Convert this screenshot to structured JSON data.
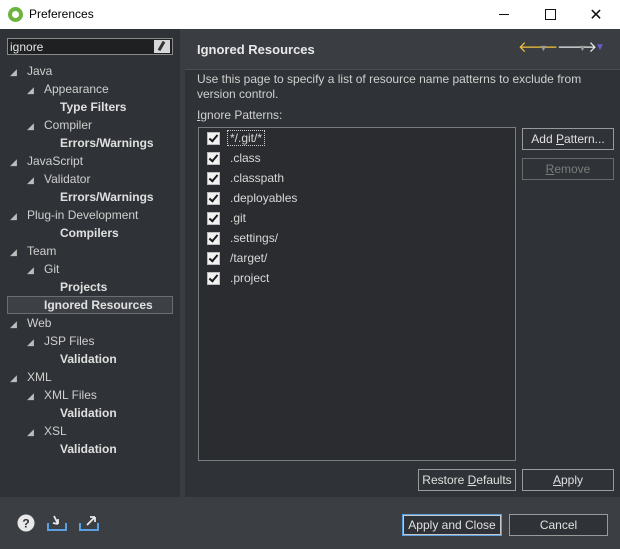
{
  "window": {
    "title": "Preferences"
  },
  "filter": {
    "value": "ignore"
  },
  "tree": [
    {
      "label": "Java",
      "level": 0,
      "bold": false,
      "arrow": true
    },
    {
      "label": "Appearance",
      "level": 1,
      "bold": false,
      "arrow": true
    },
    {
      "label": "Type Filters",
      "level": 2,
      "bold": true,
      "arrow": false
    },
    {
      "label": "Compiler",
      "level": 1,
      "bold": false,
      "arrow": true
    },
    {
      "label": "Errors/Warnings",
      "level": 2,
      "bold": true,
      "arrow": false
    },
    {
      "label": "JavaScript",
      "level": 0,
      "bold": false,
      "arrow": true
    },
    {
      "label": "Validator",
      "level": 1,
      "bold": false,
      "arrow": true
    },
    {
      "label": "Errors/Warnings",
      "level": 2,
      "bold": true,
      "arrow": false
    },
    {
      "label": "Plug-in Development",
      "level": 0,
      "bold": false,
      "arrow": true
    },
    {
      "label": "Compilers",
      "level": 2,
      "bold": true,
      "arrow": false
    },
    {
      "label": "Team",
      "level": 0,
      "bold": false,
      "arrow": true
    },
    {
      "label": "Git",
      "level": 1,
      "bold": false,
      "arrow": true
    },
    {
      "label": "Projects",
      "level": 2,
      "bold": true,
      "arrow": false
    },
    {
      "label": "Ignored Resources",
      "level": 1,
      "bold": true,
      "arrow": false,
      "selected": true
    },
    {
      "label": "Web",
      "level": 0,
      "bold": false,
      "arrow": true
    },
    {
      "label": "JSP Files",
      "level": 1,
      "bold": false,
      "arrow": true
    },
    {
      "label": "Validation",
      "level": 2,
      "bold": true,
      "arrow": false
    },
    {
      "label": "XML",
      "level": 0,
      "bold": false,
      "arrow": true
    },
    {
      "label": "XML Files",
      "level": 1,
      "bold": false,
      "arrow": true
    },
    {
      "label": "Validation",
      "level": 2,
      "bold": true,
      "arrow": false
    },
    {
      "label": "XSL",
      "level": 1,
      "bold": false,
      "arrow": true
    },
    {
      "label": "Validation",
      "level": 2,
      "bold": true,
      "arrow": false
    }
  ],
  "page": {
    "title": "Ignored Resources",
    "description": "Use this page to specify a list of resource name patterns to exclude from version control.",
    "patterns_label": "Ignore Patterns:",
    "patterns": [
      {
        "text": "*/.git/*",
        "checked": true
      },
      {
        "text": ".class",
        "checked": true
      },
      {
        "text": ".classpath",
        "checked": true
      },
      {
        "text": ".deployables",
        "checked": true
      },
      {
        "text": ".git",
        "checked": true
      },
      {
        "text": ".settings/",
        "checked": true
      },
      {
        "text": "/target/",
        "checked": true
      },
      {
        "text": ".project",
        "checked": true
      }
    ],
    "add_pattern": "Add Pattern...",
    "remove": "Remove",
    "restore_defaults": "Restore Defaults",
    "apply": "Apply"
  },
  "footer": {
    "apply_and_close": "Apply and Close",
    "cancel": "Cancel"
  },
  "colors": {
    "nav_back": "#f0c23b",
    "accent_focus": "#5aa0e0"
  }
}
